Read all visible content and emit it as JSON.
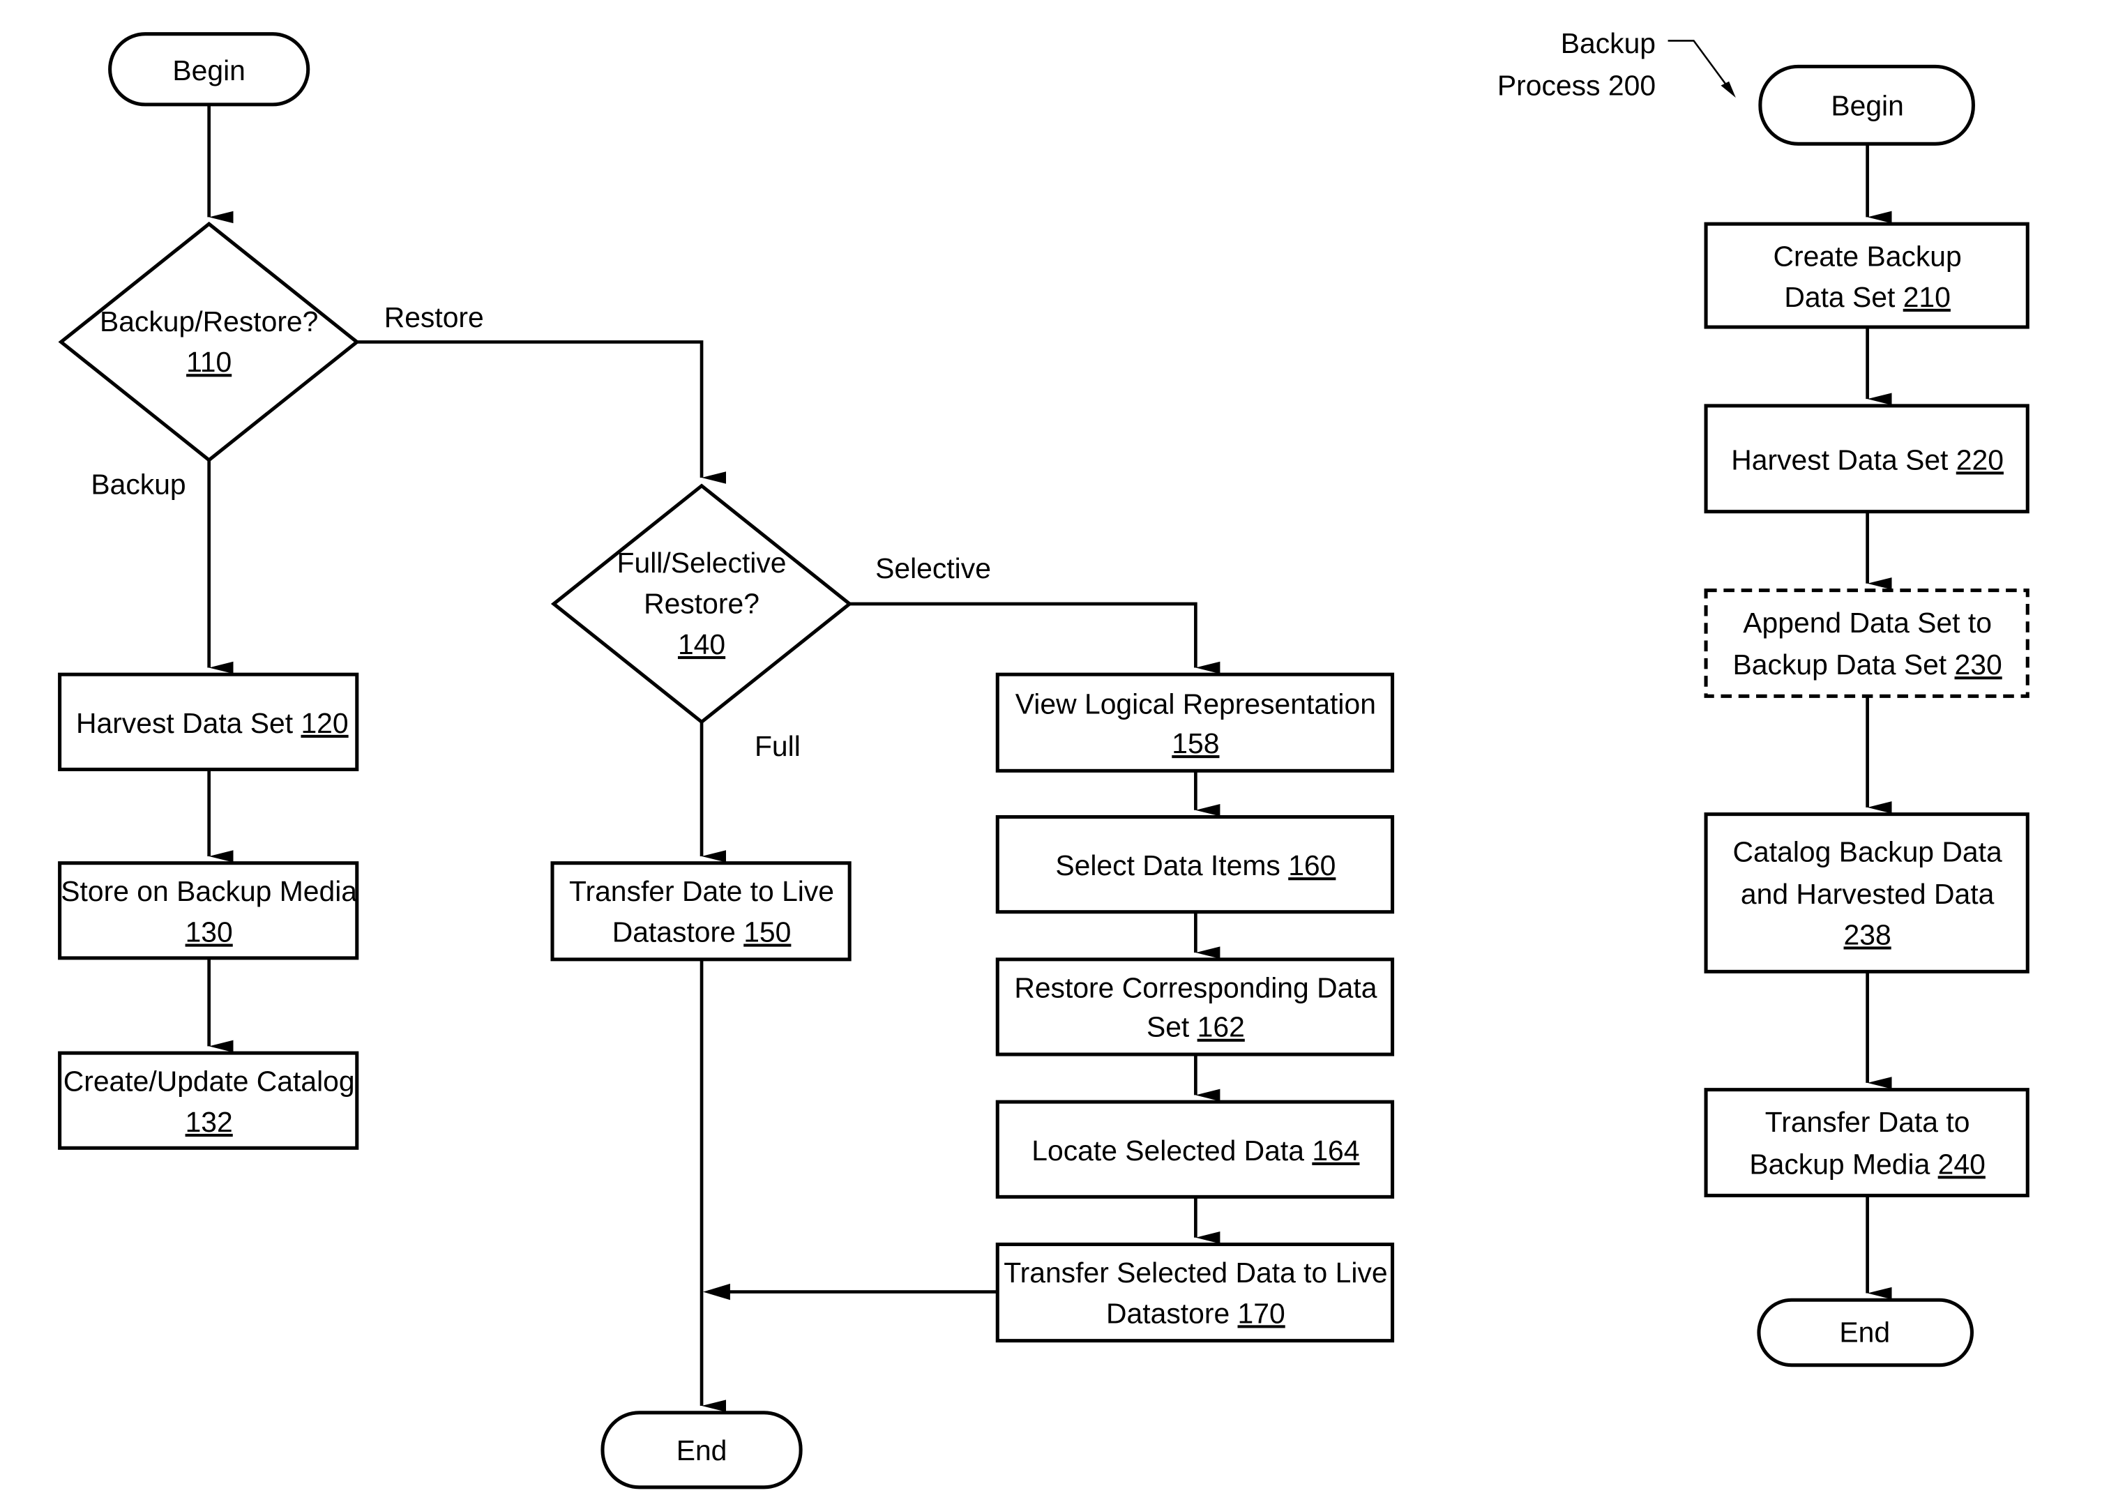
{
  "diagram": {
    "process_label": {
      "line1": "Backup",
      "line2": "Process 200"
    },
    "left_flow": {
      "begin": "Begin",
      "decision_110": {
        "text": "Backup/Restore?",
        "ref": "110"
      },
      "branch_restore": "Restore",
      "branch_backup": "Backup",
      "step_120": {
        "text": "Harvest Data Set ",
        "ref": "120"
      },
      "step_130": {
        "line1": "Store on Backup Media",
        "ref": "130"
      },
      "step_132": {
        "line1": "Create/Update Catalog",
        "ref": "132"
      },
      "decision_140": {
        "line1": "Full/Selective",
        "line2": "Restore?",
        "ref": "140"
      },
      "branch_selective": "Selective",
      "branch_full": "Full",
      "step_150": {
        "line1": "Transfer Date to Live",
        "line2": "Datastore ",
        "ref": "150"
      },
      "step_158": {
        "line1": "View Logical Representation",
        "ref": "158"
      },
      "step_160": {
        "text": "Select Data Items ",
        "ref": "160"
      },
      "step_162": {
        "line1": "Restore Corresponding Data",
        "line2": "Set ",
        "ref": "162"
      },
      "step_164": {
        "text": "Locate Selected Data ",
        "ref": "164"
      },
      "step_170": {
        "line1": "Transfer Selected Data to Live",
        "line2": "Datastore ",
        "ref": "170"
      },
      "end": "End"
    },
    "right_flow": {
      "begin": "Begin",
      "step_210": {
        "line1": "Create Backup",
        "line2": "Data Set ",
        "ref": "210"
      },
      "step_220": {
        "text": "Harvest Data Set ",
        "ref": "220"
      },
      "step_230": {
        "line1": "Append Data Set to",
        "line2": "Backup Data Set ",
        "ref": "230"
      },
      "step_238": {
        "line1": "Catalog Backup Data",
        "line2": "and Harvested Data",
        "ref": "238"
      },
      "step_240": {
        "line1": "Transfer Data to",
        "line2": "Backup Media ",
        "ref": "240"
      },
      "end": "End"
    }
  }
}
